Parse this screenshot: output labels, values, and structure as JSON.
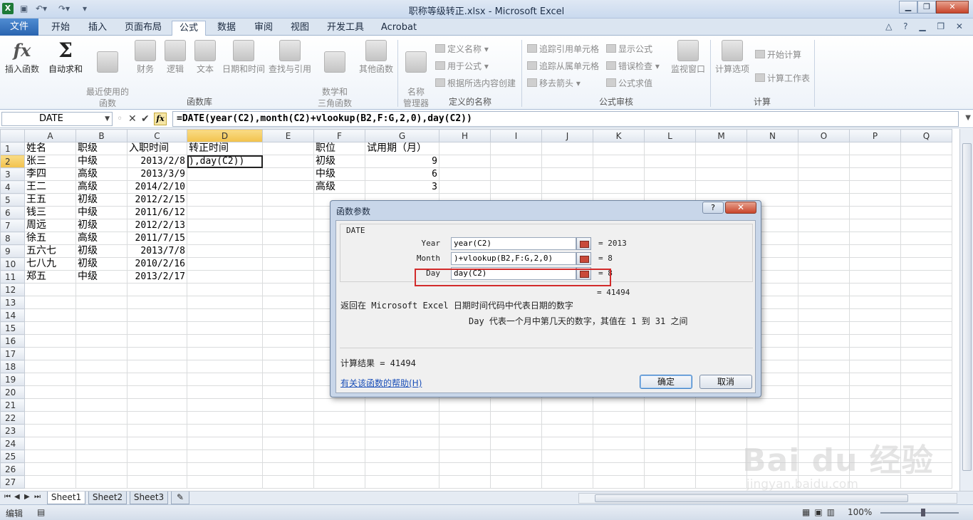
{
  "window": {
    "title": "职称等级转正.xlsx - Microsoft Excel",
    "buttons": [
      "▁",
      "❐",
      "✕"
    ]
  },
  "ribbon_tabs": [
    "文件",
    "开始",
    "插入",
    "页面布局",
    "公式",
    "数据",
    "审阅",
    "视图",
    "开发工具",
    "Acrobat"
  ],
  "ribbon": {
    "insert_function": "插入函数",
    "autosum": "自动求和",
    "recent": "最近使用的\n函数",
    "financial": "财务",
    "logical": "逻辑",
    "text": "文本",
    "datetime": "日期和时间",
    "lookup": "查找与引用",
    "math": "数学和\n三角函数",
    "other": "其他函数",
    "name_manager": "名称\n管理器",
    "define_name": "定义名称",
    "use_in_formula": "用于公式",
    "create_from_selection": "根据所选内容创建",
    "trace_precedents": "追踪引用单元格",
    "trace_dependents": "追踪从属单元格",
    "remove_arrows": "移去箭头",
    "show_formulas": "显示公式",
    "error_checking": "错误检查",
    "evaluate_formula": "公式求值",
    "watch_window": "监视窗口",
    "calc_options": "计算选项",
    "calc_now": "开始计算",
    "calc_sheet": "计算工作表",
    "groups": {
      "function_library": "函数库",
      "defined_names": "定义的名称",
      "formula_auditing": "公式审核",
      "calculation": "计算"
    }
  },
  "formula_bar": {
    "name_box": "DATE",
    "formula": "=DATE(year(C2),month(C2)+vlookup(B2,F:G,2,0),day(C2))"
  },
  "columns": [
    "A",
    "B",
    "C",
    "D",
    "E",
    "F",
    "G",
    "H",
    "I",
    "J",
    "K",
    "L",
    "M",
    "N",
    "O",
    "P",
    "Q"
  ],
  "rows": [
    {
      "n": "1",
      "A": "姓名",
      "B": "职级",
      "C": "入职时间",
      "D": "转正时间",
      "F": "职位",
      "G": "试用期（月）"
    },
    {
      "n": "2",
      "A": "张三",
      "B": "中级",
      "C": "2013/2/8",
      "D": "),day(C2))",
      "F": "初级",
      "G": "9"
    },
    {
      "n": "3",
      "A": "李四",
      "B": "高级",
      "C": "2013/3/9",
      "F": "中级",
      "G": "6"
    },
    {
      "n": "4",
      "A": "王二",
      "B": "高级",
      "C": "2014/2/10",
      "F": "高级",
      "G": "3"
    },
    {
      "n": "5",
      "A": "王五",
      "B": "初级",
      "C": "2012/2/15"
    },
    {
      "n": "6",
      "A": "钱三",
      "B": "中级",
      "C": "2011/6/12"
    },
    {
      "n": "7",
      "A": "周远",
      "B": "初级",
      "C": "2012/2/13"
    },
    {
      "n": "8",
      "A": "徐五",
      "B": "高级",
      "C": "2011/7/15"
    },
    {
      "n": "9",
      "A": "五六七",
      "B": "初级",
      "C": "2013/7/8"
    },
    {
      "n": "10",
      "A": "七八九",
      "B": "初级",
      "C": "2010/2/16"
    },
    {
      "n": "11",
      "A": "郑五",
      "B": "中级",
      "C": "2013/2/17"
    },
    {
      "n": "12"
    },
    {
      "n": "13"
    },
    {
      "n": "14"
    },
    {
      "n": "15"
    },
    {
      "n": "16"
    },
    {
      "n": "17"
    },
    {
      "n": "18"
    },
    {
      "n": "19"
    },
    {
      "n": "20"
    },
    {
      "n": "21"
    },
    {
      "n": "22"
    },
    {
      "n": "23"
    },
    {
      "n": "24"
    },
    {
      "n": "25"
    },
    {
      "n": "26"
    },
    {
      "n": "27"
    }
  ],
  "sheets": [
    "Sheet1",
    "Sheet2",
    "Sheet3"
  ],
  "status": {
    "mode": "编辑",
    "zoom": "100%"
  },
  "dialog": {
    "title": "函数参数",
    "help_btn": "?",
    "close_btn": "✕",
    "function_name": "DATE",
    "args": [
      {
        "label": "Year",
        "value": "year(C2)",
        "result": "=  2013"
      },
      {
        "label": "Month",
        "value": ")+vlookup(B2,F:G,2,0)",
        "result": "=  8"
      },
      {
        "label": "Day",
        "value": "day(C2)",
        "result": "=  8"
      }
    ],
    "total_result": "=  41494",
    "description": "返回在 Microsoft Excel 日期时间代码中代表日期的数字",
    "arg_description": "Day  代表一个月中第几天的数字，其值在 1 到 31 之间",
    "calc_result": "计算结果 =  41494",
    "help_link": "有关该函数的帮助(H)",
    "ok": "确定",
    "cancel": "取消"
  },
  "watermark": {
    "line1": "Bai du 经验",
    "line2": "jingyan.baidu.com"
  },
  "colors": {
    "accent": "#2a64b0",
    "highlight_box": "#d22b2b",
    "selected_header": "#f2c24c"
  }
}
